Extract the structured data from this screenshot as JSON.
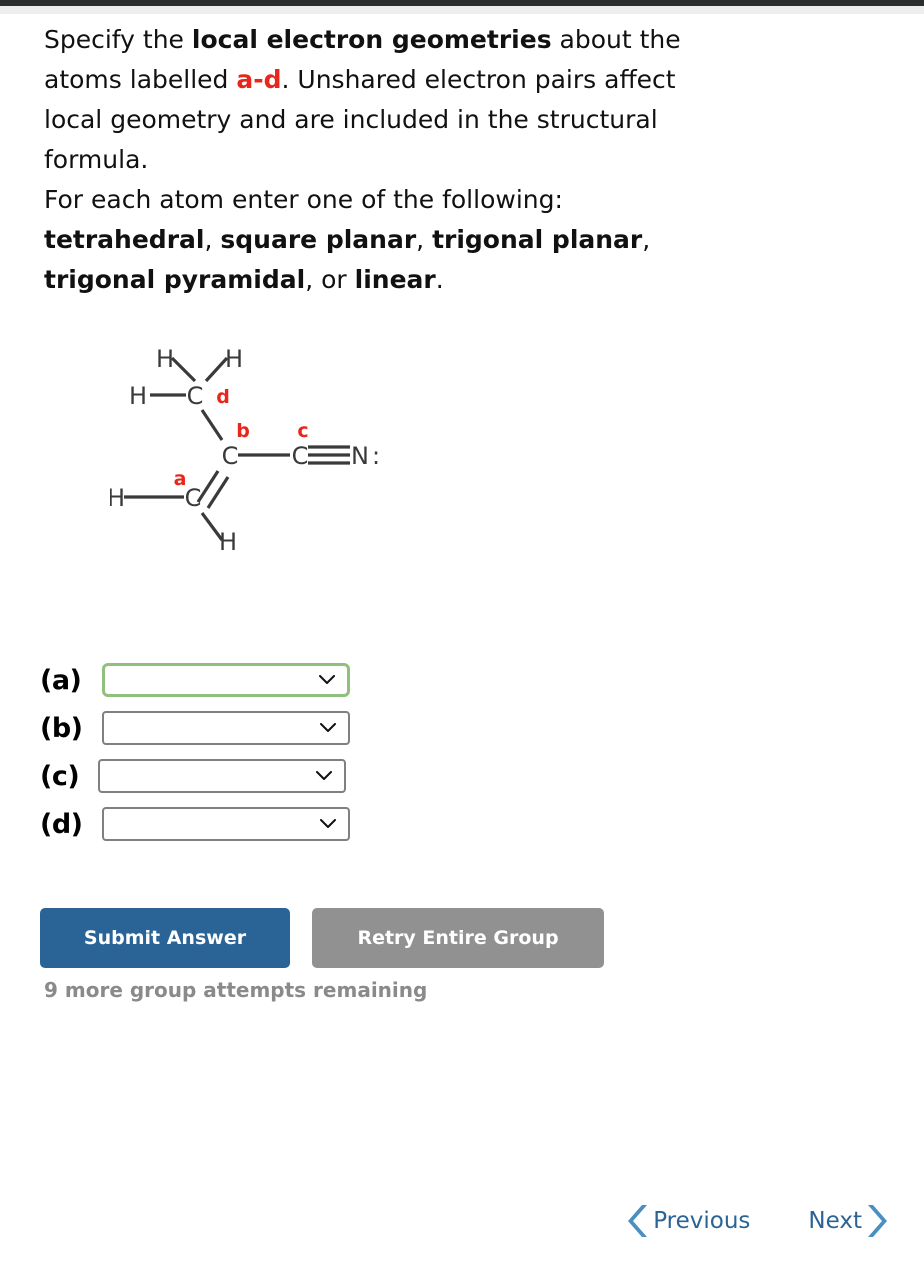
{
  "prompt": {
    "line1_a": "Specify the ",
    "line1_b": "local electron geometries",
    "line1_c": " about the",
    "line2_a": "atoms labelled ",
    "line2_b": "a-d",
    "line2_c": ". Unshared electron pairs affect",
    "line3": "local geometry and are included in the structural",
    "line4": "formula.",
    "line5": "For each atom enter one of the following:",
    "options_line1_a": "tetrahedral",
    "options_line1_sep1": ", ",
    "options_line1_b": "square planar",
    "options_line1_sep2": ", ",
    "options_line1_c": "trigonal planar",
    "options_line1_end": ",",
    "options_line2_a": "trigonal pyramidal",
    "options_line2_sep": ", or ",
    "options_line2_b": "linear",
    "options_line2_end": "."
  },
  "molecule": {
    "atoms": {
      "h_top_left": "H",
      "h_top_right": "H",
      "h_left_upper": "H",
      "c_methyl": "C",
      "c_center": "C",
      "c_nitrile": "C",
      "n_nitrile": "N",
      "lone_pair": ":",
      "h_left_lower": "H",
      "c_bottom": "C",
      "h_bottom": "H"
    },
    "labels": {
      "a": "a",
      "b": "b",
      "c": "c",
      "d": "d"
    },
    "label_color": "#e8261c",
    "bond_color": "#3a3a3a"
  },
  "answers": {
    "rows": [
      {
        "label": "(a)",
        "value": "",
        "focused": true
      },
      {
        "label": "(b)",
        "value": "",
        "focused": false
      },
      {
        "label": "(c)",
        "value": "",
        "focused": false
      },
      {
        "label": "(d)",
        "value": "",
        "focused": false
      }
    ],
    "focus_border_color": "#8fc07e",
    "border_color": "#808080"
  },
  "buttons": {
    "submit_label": "Submit Answer",
    "retry_label": "Retry Entire Group",
    "submit_color": "#2a6496",
    "retry_color": "#919191"
  },
  "status": {
    "attempts_text": "9 more group attempts remaining",
    "attempts_color": "#8a8a8a"
  },
  "navigation": {
    "previous_label": "Previous",
    "next_label": "Next",
    "link_color": "#2a6496",
    "chevron_color": "#4a8fc0"
  }
}
